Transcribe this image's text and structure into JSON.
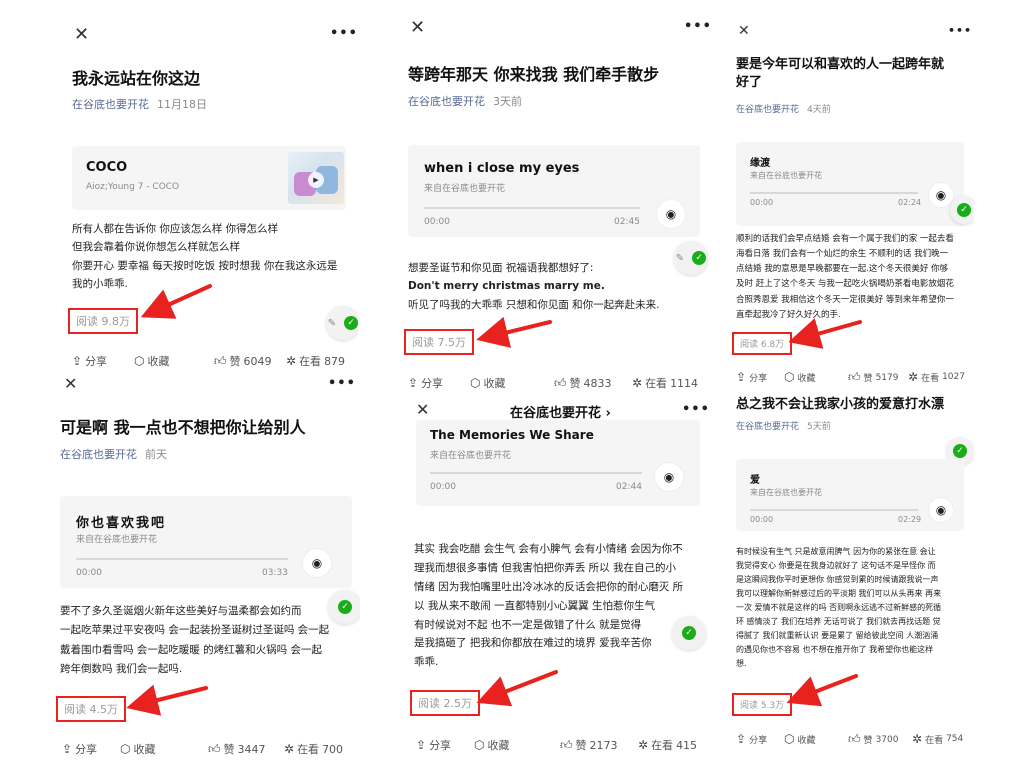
{
  "colors": {
    "accent_red": "#e8231f",
    "author_blue": "#576b95",
    "meta_gray": "#8a8a8a",
    "wechat_green": "#1aad19"
  },
  "common": {
    "close_icon": "✕",
    "more_icon": "•••",
    "play_icon": "wave-play-icon",
    "time_start": "00:00",
    "from_prefix": "来自在谷底也要开花",
    "share_label": "分享",
    "collect_label": "收藏",
    "like_prefix": "赞",
    "watch_prefix": "在看"
  },
  "cards": [
    {
      "title": "我永远站在你这边",
      "author": "在谷底也要开花",
      "date": "11月18日",
      "song": "COCO",
      "artist": "Aioz;Young 7 - COCO",
      "lines": [
        "所有人都在告诉你 你应该怎么样 你得怎么样",
        "但我会靠着你说你想怎么样就怎么样",
        "你要开心 要幸福 每天按时吃饭 按时想我 你在我这永远是",
        "我的小乖乖."
      ],
      "read": "阅读 9.8万",
      "likes": "6049",
      "watching": "879"
    },
    {
      "title": "等跨年那天 你来找我 我们牵手散步",
      "author": "在谷底也要开花",
      "date": "3天前",
      "song": "when i close my eyes",
      "time_end": "02:45",
      "lines": [
        "想要圣诞节和你见面 祝福语我都想好了:",
        "Don't merry christmas marry me.",
        "听见了吗我的大乖乖 只想和你见面 和你一起奔赴未来."
      ],
      "read": "阅读 7.5万",
      "likes": "4833",
      "watching": "1114"
    },
    {
      "title_lines": [
        "要是今年可以和喜欢的人一起跨年就",
        "好了"
      ],
      "author": "在谷底也要开花",
      "date": "4天前",
      "song": "缘渡",
      "time_end": "02:24",
      "lines": [
        "顺利的话我们会早点结婚 会有一个属于我们的家 一起去看",
        "海看日落 我们会有一个灿烂的余生 不顺利的话 我们晚一",
        "点结婚 我的意思是早晚都要在一起.这个冬天很美好 你够",
        "及时 赶上了这个冬天 与我一起吃火锅喝奶茶看电影放烟花",
        "合照秀恩爱 我相信这个冬天一定很美好 等到来年希望你一",
        "直牵起我冷了好久好久的手."
      ],
      "read": "阅读 6.8万",
      "likes": "5179",
      "watching": "1027"
    },
    {
      "title": "可是啊 我一点也不想把你让给别人",
      "author": "在谷底也要开花",
      "date": "前天",
      "song": "你也喜欢我吧",
      "time_end": "03:33",
      "lines": [
        "要不了多久圣诞烟火新年这些美好与温柔都会如约而",
        "一起吃苹果过平安夜吗 会一起装扮圣诞树过圣诞吗 会一起",
        "戴着围巾看雪吗 会一起吃暖暖 的烤红薯和火锅吗 会一起",
        "跨年倒数吗 我们会一起吗."
      ],
      "read": "阅读 4.5万",
      "likes": "3447",
      "watching": "700"
    },
    {
      "header": "在谷底也要开花 ›",
      "song": "The Memories We Share",
      "time_end": "02:44",
      "lines": [
        "其实 我会吃醋 会生气 会有小脾气 会有小情绪 会因为你不",
        "理我而想很多事情 但我害怕把你弄丢 所以 我在自己的小",
        "情绪 因为我怕嘴里吐出冷冰冰的反话会把你的耐心磨灭 所",
        "以 我从来不敢闹 一直都特别小心翼翼 生怕惹你生气",
        "有时候说对不起  也不一定是做错了什么   就是觉得",
        "是我搞砸了  把我和你都放在难过的境界  爱我辛苦你",
        "乖乖."
      ],
      "read": "阅读 2.5万",
      "likes": "2173",
      "watching": "415"
    },
    {
      "title": "总之我不会让我家小孩的爱意打水漂",
      "author": "在谷底也要开花",
      "date": "5天前",
      "song": "爱",
      "time_end": "02:29",
      "lines": [
        "有时候没有生气 只是故意闹脾气 因为你的紧张在意 会让",
        "我觉得安心  你要是在我身边就好了 这句话不是早怪你 而",
        "是这瞬间我你平时更想你 你感觉到累的时候请跟我说一声",
        "我可以理解你新鲜感过后的平淡期 我们可以从头再来 再来",
        "一次 爱情不就是这样的吗 否则啊永远逃不过新鲜感的死循",
        "环 感情淡了 我们在培养 无话可说了 我们就去再找话题 觉",
        "得腻了 我们就重新认识 要是累了 留给彼此空间 人潮汹涌",
        "的遇见你也不容易 也不想在推开你了 我希望你也能这样",
        "想."
      ],
      "read": "阅读 5.3万",
      "likes": "3700",
      "watching": "754"
    }
  ]
}
